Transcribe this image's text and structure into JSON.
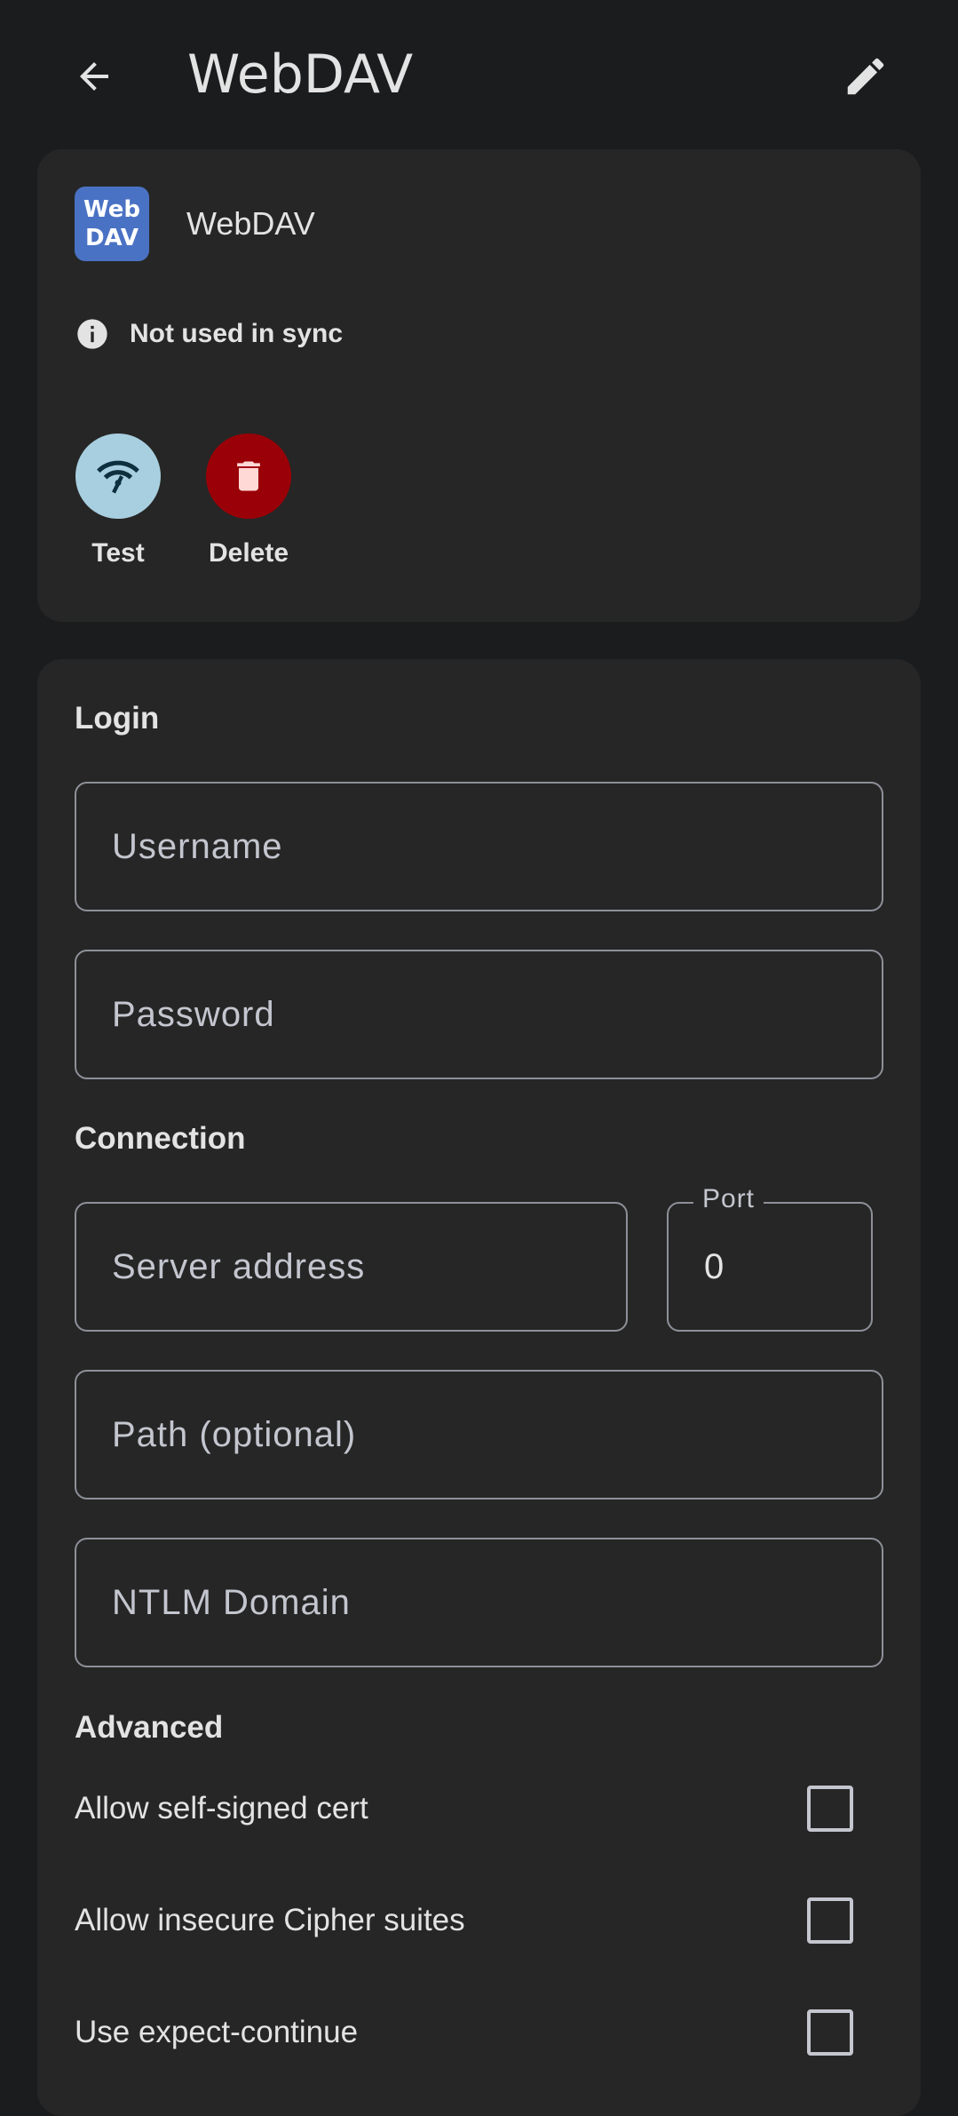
{
  "appbar": {
    "title": "WebDAV",
    "back_icon": "arrow-back-icon",
    "edit_icon": "pencil-icon"
  },
  "account": {
    "logo_line1": "Web",
    "logo_line2": "DAV",
    "name": "WebDAV",
    "status": "Not used in sync"
  },
  "actions": {
    "test_label": "Test",
    "delete_label": "Delete"
  },
  "login": {
    "heading": "Login",
    "username_placeholder": "Username",
    "password_placeholder": "Password"
  },
  "connection": {
    "heading": "Connection",
    "server_placeholder": "Server address",
    "port_label": "Port",
    "port_value": "0",
    "path_placeholder": "Path (optional)",
    "ntlm_placeholder": "NTLM Domain"
  },
  "advanced": {
    "heading": "Advanced",
    "options": [
      {
        "label": "Allow self-signed cert",
        "checked": false
      },
      {
        "label": "Allow insecure Cipher suites",
        "checked": false
      },
      {
        "label": "Use expect-continue",
        "checked": false
      }
    ]
  },
  "colors": {
    "background": "#1a1c1e",
    "card": "#262626",
    "test_button": "#a8cfe0",
    "delete_button": "#9a0007",
    "logo": "#4a72c4"
  }
}
